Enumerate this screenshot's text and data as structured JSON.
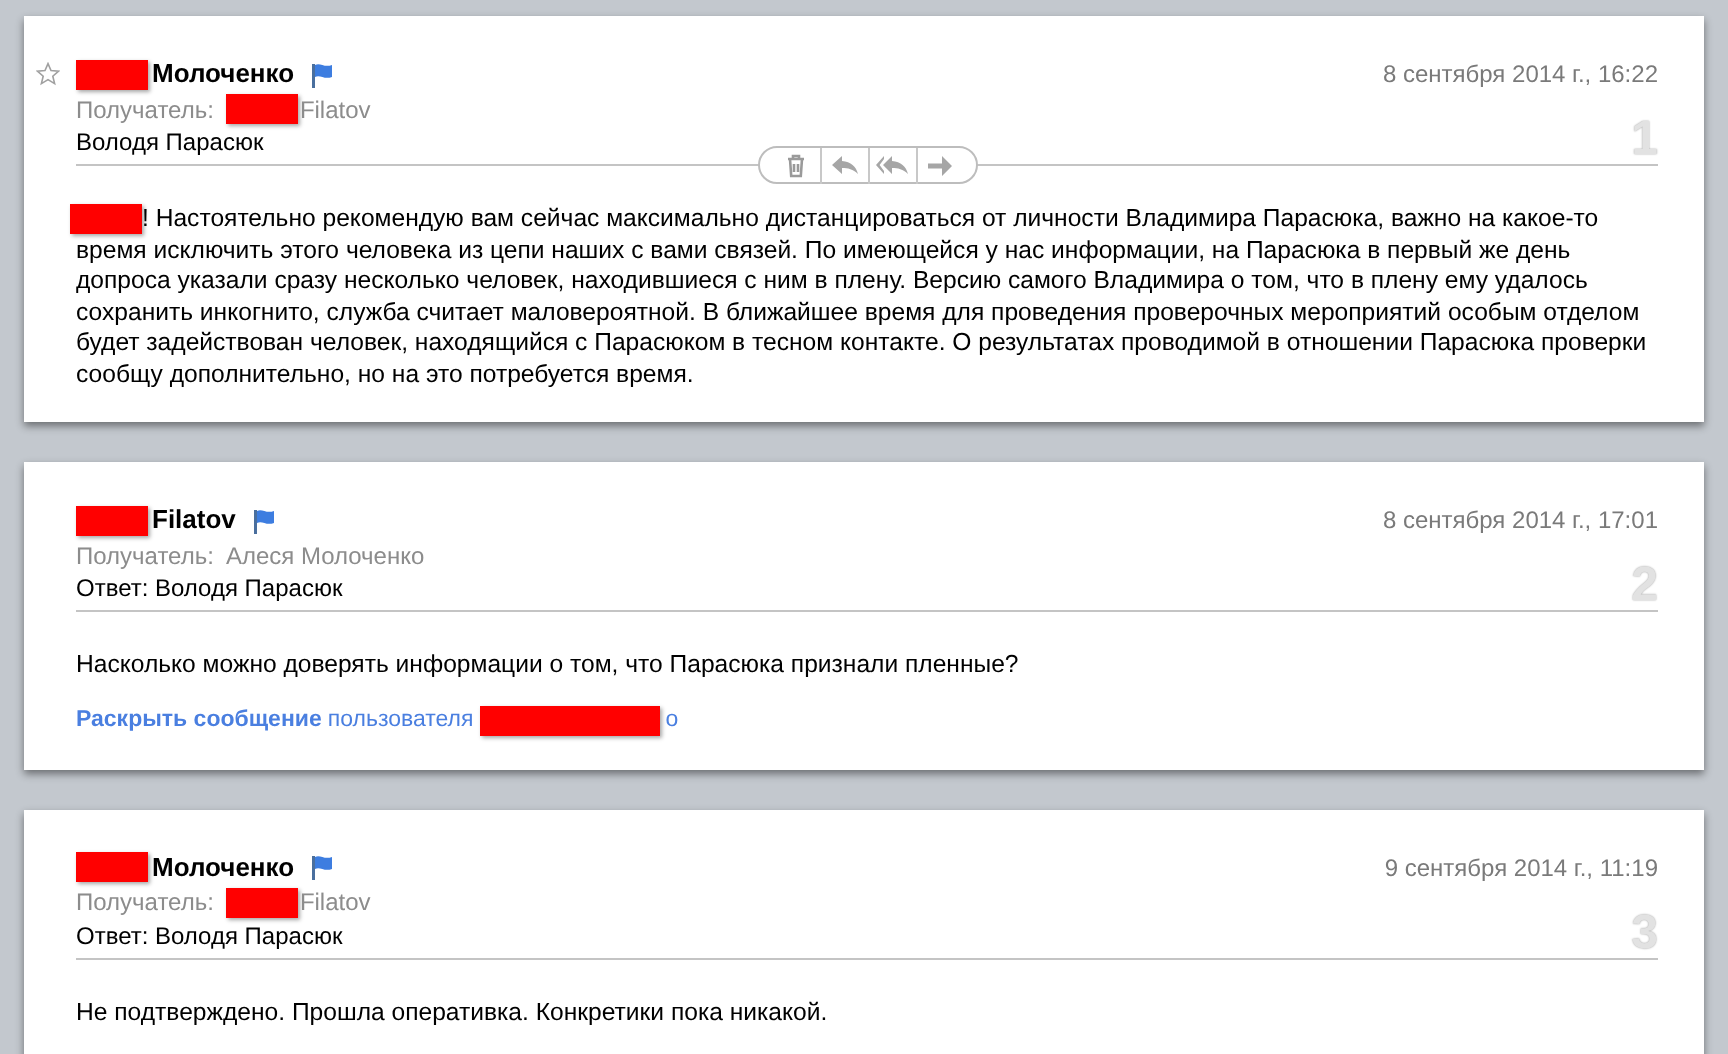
{
  "messages": [
    {
      "hovered": true,
      "flagged": true,
      "sender": [
        {
          "kind": "redaction"
        },
        {
          "kind": "text",
          "text": "Молоченко"
        }
      ],
      "date": "8 сентября 2014 г., 16:22",
      "recipient_label": "Получатель:",
      "recipient": [
        {
          "kind": "redaction"
        },
        {
          "kind": "text",
          "text": "Filatov"
        }
      ],
      "subject": "Володя Парасюк",
      "number": "1",
      "body": [
        [
          {
            "kind": "redaction"
          },
          {
            "kind": "text",
            "text": "! Настоятельно рекомендую вам сейчас максимально дистанцироваться от личности Владимира Парасюка, важно на какое-то"
          }
        ],
        [
          {
            "kind": "text",
            "text": "время исключить этого человека из цепи наших с вами связей. По имеющейся у нас информации, на Парасюка в первый же день допроса указали сразу несколько человек, находившиеся с ним в плену. Версию самого Владимира о том, что в плену ему удалось сохранить инкогнито, служба считает маловероятной. В ближайшее время для проведения проверочных мероприятий особым отделом будет задействован человек, находящийся с Парасюком в тесном контакте. О результатах проводимой в отношении Парасюка проверки сообщу дополнительно, но на это потребуется время."
          }
        ]
      ]
    },
    {
      "hovered": false,
      "flagged": true,
      "sender": [
        {
          "kind": "redaction"
        },
        {
          "kind": "text",
          "text": "Filatov"
        }
      ],
      "date": "8 сентября 2014 г., 17:01",
      "recipient_label": "Получатель:",
      "recipient": [
        {
          "kind": "text",
          "text": "Алеся Молоченко"
        }
      ],
      "subject": "Ответ: Володя Парасюк",
      "number": "2",
      "body": [
        [
          {
            "kind": "text",
            "text": "Насколько можно доверять информации о том, что Парасюка признали пленные?"
          }
        ]
      ],
      "expand": [
        {
          "kind": "link-bold",
          "text": "Раскрыть сообщение"
        },
        {
          "kind": "link",
          "text": "пользователя"
        },
        {
          "kind": "redaction-long"
        },
        {
          "kind": "link",
          "text": "о"
        }
      ]
    },
    {
      "hovered": false,
      "flagged": true,
      "sender": [
        {
          "kind": "redaction"
        },
        {
          "kind": "text",
          "text": "Молоченко"
        }
      ],
      "date": "9 сентября 2014 г., 11:19",
      "recipient_label": "Получатель:",
      "recipient": [
        {
          "kind": "redaction"
        },
        {
          "kind": "text",
          "text": "Filatov"
        }
      ],
      "subject": "Ответ: Володя Парасюк",
      "number": "3",
      "body": [
        [
          {
            "kind": "text",
            "text": "Не подтверждено. Прошла оперативка. Конкретики пока никакой."
          }
        ]
      ]
    }
  ]
}
